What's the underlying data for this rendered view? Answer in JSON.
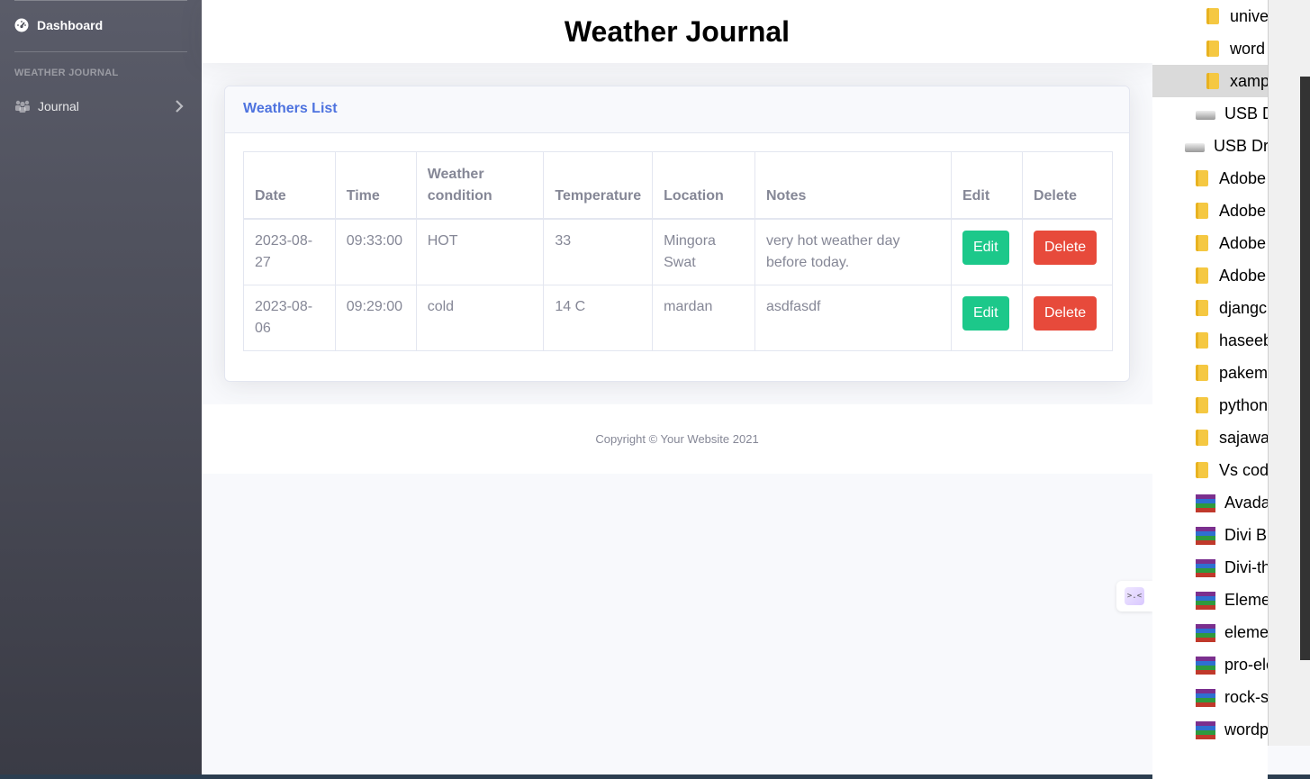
{
  "sidebar": {
    "dashboard_label": "Dashboard",
    "heading": "WEATHER JOURNAL",
    "journal_label": "Journal"
  },
  "topbar": {
    "title": "Weather Journal"
  },
  "card": {
    "title": "Weathers List",
    "columns": [
      "Date",
      "Time",
      "Weather condition",
      "Temperature",
      "Location",
      "Notes",
      "Edit",
      "Delete"
    ],
    "rows": [
      {
        "date": "2023-08-27",
        "time": "09:33:00",
        "condition": "HOT",
        "temperature": "33",
        "location": "Mingora Swat",
        "notes": "very hot weather day before today.",
        "edit": "Edit",
        "delete": "Delete"
      },
      {
        "date": "2023-08-06",
        "time": "09:29:00",
        "condition": "cold",
        "temperature": "14 C",
        "location": "mardan",
        "notes": "asdfasdf",
        "edit": "Edit",
        "delete": "Delete"
      }
    ]
  },
  "footer": {
    "copyright": "Copyright © Your Website 2021"
  },
  "explorer": {
    "items": [
      {
        "label": "unive",
        "type": "folder"
      },
      {
        "label": "word",
        "type": "folder"
      },
      {
        "label": "xamp",
        "type": "folder",
        "selected": true
      },
      {
        "label": "USB Dr",
        "type": "drive"
      },
      {
        "label": "USB Driv",
        "type": "drive"
      },
      {
        "label": "Adobe",
        "type": "folder"
      },
      {
        "label": "Adobe",
        "type": "folder"
      },
      {
        "label": "Adobe",
        "type": "folder"
      },
      {
        "label": "Adobe",
        "type": "folder"
      },
      {
        "label": "djangc",
        "type": "folder"
      },
      {
        "label": "haseeb",
        "type": "folder"
      },
      {
        "label": "pakem",
        "type": "folder"
      },
      {
        "label": "python",
        "type": "folder"
      },
      {
        "label": "sajawa",
        "type": "folder"
      },
      {
        "label": "Vs cod",
        "type": "folder"
      },
      {
        "label": "Avada",
        "type": "archive"
      },
      {
        "label": "Divi Bu",
        "type": "archive"
      },
      {
        "label": "Divi-th",
        "type": "archive"
      },
      {
        "label": "Elemer",
        "type": "archive"
      },
      {
        "label": "elemer",
        "type": "archive"
      },
      {
        "label": "pro-ele",
        "type": "archive"
      },
      {
        "label": "rock-si",
        "type": "archive"
      },
      {
        "label": "wordp",
        "type": "archive"
      }
    ]
  },
  "colors": {
    "primary": "#4e73df",
    "success": "#1cc88a",
    "danger": "#e74a3b",
    "sidebar_top": "#5a5c69",
    "sidebar_bottom": "#3a3b45"
  }
}
